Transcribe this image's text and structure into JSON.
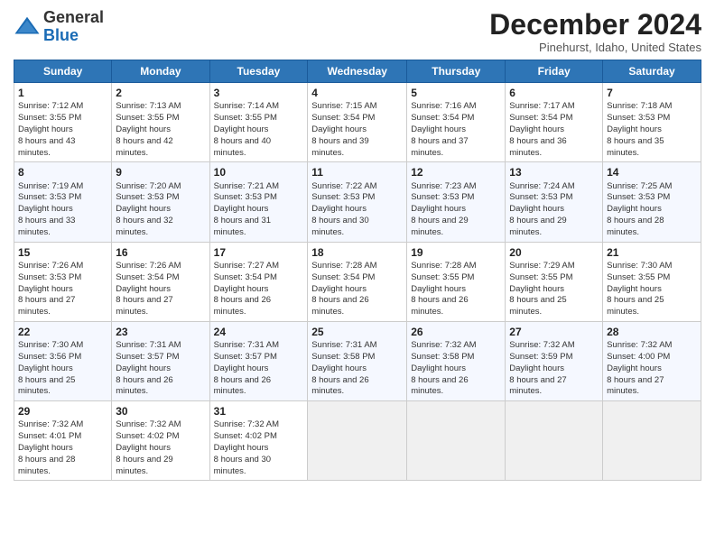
{
  "header": {
    "logo_line1": "General",
    "logo_line2": "Blue",
    "month_title": "December 2024",
    "location": "Pinehurst, Idaho, United States"
  },
  "weekdays": [
    "Sunday",
    "Monday",
    "Tuesday",
    "Wednesday",
    "Thursday",
    "Friday",
    "Saturday"
  ],
  "weeks": [
    [
      {
        "day": "1",
        "sr": "7:12 AM",
        "ss": "3:55 PM",
        "dl": "8 hours and 43 minutes."
      },
      {
        "day": "2",
        "sr": "7:13 AM",
        "ss": "3:55 PM",
        "dl": "8 hours and 42 minutes."
      },
      {
        "day": "3",
        "sr": "7:14 AM",
        "ss": "3:55 PM",
        "dl": "8 hours and 40 minutes."
      },
      {
        "day": "4",
        "sr": "7:15 AM",
        "ss": "3:54 PM",
        "dl": "8 hours and 39 minutes."
      },
      {
        "day": "5",
        "sr": "7:16 AM",
        "ss": "3:54 PM",
        "dl": "8 hours and 37 minutes."
      },
      {
        "day": "6",
        "sr": "7:17 AM",
        "ss": "3:54 PM",
        "dl": "8 hours and 36 minutes."
      },
      {
        "day": "7",
        "sr": "7:18 AM",
        "ss": "3:53 PM",
        "dl": "8 hours and 35 minutes."
      }
    ],
    [
      {
        "day": "8",
        "sr": "7:19 AM",
        "ss": "3:53 PM",
        "dl": "8 hours and 33 minutes."
      },
      {
        "day": "9",
        "sr": "7:20 AM",
        "ss": "3:53 PM",
        "dl": "8 hours and 32 minutes."
      },
      {
        "day": "10",
        "sr": "7:21 AM",
        "ss": "3:53 PM",
        "dl": "8 hours and 31 minutes."
      },
      {
        "day": "11",
        "sr": "7:22 AM",
        "ss": "3:53 PM",
        "dl": "8 hours and 30 minutes."
      },
      {
        "day": "12",
        "sr": "7:23 AM",
        "ss": "3:53 PM",
        "dl": "8 hours and 29 minutes."
      },
      {
        "day": "13",
        "sr": "7:24 AM",
        "ss": "3:53 PM",
        "dl": "8 hours and 29 minutes."
      },
      {
        "day": "14",
        "sr": "7:25 AM",
        "ss": "3:53 PM",
        "dl": "8 hours and 28 minutes."
      }
    ],
    [
      {
        "day": "15",
        "sr": "7:26 AM",
        "ss": "3:53 PM",
        "dl": "8 hours and 27 minutes."
      },
      {
        "day": "16",
        "sr": "7:26 AM",
        "ss": "3:54 PM",
        "dl": "8 hours and 27 minutes."
      },
      {
        "day": "17",
        "sr": "7:27 AM",
        "ss": "3:54 PM",
        "dl": "8 hours and 26 minutes."
      },
      {
        "day": "18",
        "sr": "7:28 AM",
        "ss": "3:54 PM",
        "dl": "8 hours and 26 minutes."
      },
      {
        "day": "19",
        "sr": "7:28 AM",
        "ss": "3:55 PM",
        "dl": "8 hours and 26 minutes."
      },
      {
        "day": "20",
        "sr": "7:29 AM",
        "ss": "3:55 PM",
        "dl": "8 hours and 25 minutes."
      },
      {
        "day": "21",
        "sr": "7:30 AM",
        "ss": "3:55 PM",
        "dl": "8 hours and 25 minutes."
      }
    ],
    [
      {
        "day": "22",
        "sr": "7:30 AM",
        "ss": "3:56 PM",
        "dl": "8 hours and 25 minutes."
      },
      {
        "day": "23",
        "sr": "7:31 AM",
        "ss": "3:57 PM",
        "dl": "8 hours and 26 minutes."
      },
      {
        "day": "24",
        "sr": "7:31 AM",
        "ss": "3:57 PM",
        "dl": "8 hours and 26 minutes."
      },
      {
        "day": "25",
        "sr": "7:31 AM",
        "ss": "3:58 PM",
        "dl": "8 hours and 26 minutes."
      },
      {
        "day": "26",
        "sr": "7:32 AM",
        "ss": "3:58 PM",
        "dl": "8 hours and 26 minutes."
      },
      {
        "day": "27",
        "sr": "7:32 AM",
        "ss": "3:59 PM",
        "dl": "8 hours and 27 minutes."
      },
      {
        "day": "28",
        "sr": "7:32 AM",
        "ss": "4:00 PM",
        "dl": "8 hours and 27 minutes."
      }
    ],
    [
      {
        "day": "29",
        "sr": "7:32 AM",
        "ss": "4:01 PM",
        "dl": "8 hours and 28 minutes."
      },
      {
        "day": "30",
        "sr": "7:32 AM",
        "ss": "4:02 PM",
        "dl": "8 hours and 29 minutes."
      },
      {
        "day": "31",
        "sr": "7:32 AM",
        "ss": "4:02 PM",
        "dl": "8 hours and 30 minutes."
      },
      null,
      null,
      null,
      null
    ]
  ]
}
